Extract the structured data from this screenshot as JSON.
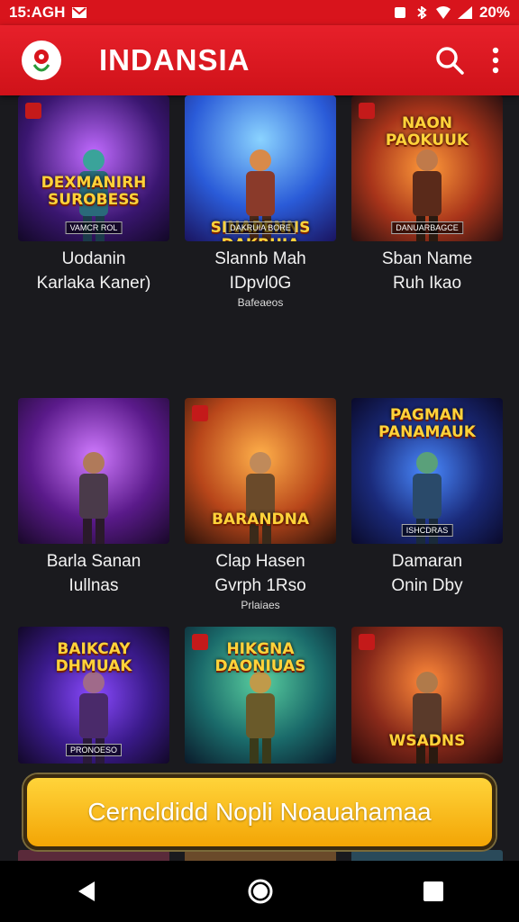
{
  "status_bar": {
    "time": "15:AGH",
    "battery": "20%"
  },
  "app": {
    "title": "INDANSIA"
  },
  "games": [
    {
      "art_title": "DEXMANIRH\nSUROBESS",
      "badge": "VAMCR ROL",
      "line1": "Uodanin",
      "line2": "Karlaka Kaner)",
      "line3": ""
    },
    {
      "art_title": "SINAPENNS\nDAKRUIA",
      "badge": "DAKRUIA BORE",
      "line1": "Slannb Mah",
      "line2": "IDpvl0G",
      "line3": "Bafeaeos"
    },
    {
      "art_title": "NAON\nPAOKUUK",
      "badge": "DANUARBAGCE",
      "line1": "Sban Name",
      "line2": "Ruh Ikao",
      "line3": ""
    },
    {
      "art_title": "",
      "badge": "",
      "line1": "Barla Sanan",
      "line2": "Iullnas",
      "line3": ""
    },
    {
      "art_title": "BARANDNA",
      "badge": "",
      "line1": "Clap Hasen",
      "line2": "Gvrph 1Rso",
      "line3": "Prlaiaes"
    },
    {
      "art_title": "PAGMAN\nPANAMAUK",
      "badge": "ISHCDRAS",
      "line1": "Damaran",
      "line2": "Onin Dby",
      "line3": ""
    },
    {
      "art_title": "BAIKCAY\nDHMUAK",
      "badge": "PRONOESO",
      "line1": "",
      "line2": "",
      "line3": ""
    },
    {
      "art_title": "HIKGNA\nDAONIUAS",
      "badge": "",
      "line1": "",
      "line2": "",
      "line3": ""
    },
    {
      "art_title": "WSADNS",
      "badge": "",
      "line1": "",
      "line2": "",
      "line3": ""
    }
  ],
  "cta": {
    "label": "Cerncldidd Nopli Noauahamaa"
  },
  "colors": {
    "accent": "#e01e26",
    "cta": "#f6b716",
    "background": "#1a1a1e"
  },
  "icons": [
    "gmail-icon",
    "search-icon",
    "more-vert-icon",
    "back-icon",
    "home-icon",
    "recents-icon"
  ]
}
